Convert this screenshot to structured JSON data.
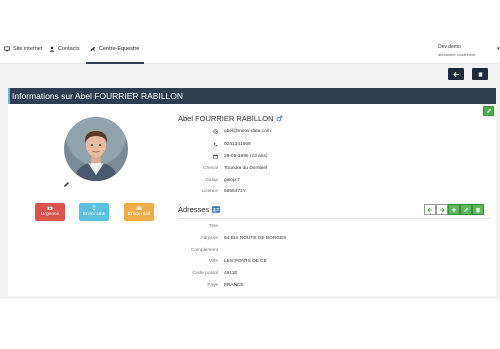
{
  "nav": {
    "tabs": [
      {
        "label": "Site internet",
        "icon": "desktop-icon"
      },
      {
        "label": "Contacts",
        "icon": "user-icon"
      },
      {
        "label": "Centre-Equestre",
        "icon": "horse-icon"
      }
    ],
    "user_name": "Dev demo",
    "user_sub": "alexandre coudreuse"
  },
  "toolbar": {
    "back_icon": "arrow-left-icon",
    "stop_icon": "stop-icon"
  },
  "page_title": "Informations sur Abel FOURRIER RABILLON",
  "profile": {
    "actions": [
      {
        "label": "Urgence",
        "icon": "ambulance-icon",
        "color": "#d9534f"
      },
      {
        "label": "Envoi sms",
        "icon": "mobile-icon",
        "color": "#5bc0de"
      },
      {
        "label": "Envoi mail",
        "icon": "envelope-icon",
        "color": "#f0ad4e"
      }
    ]
  },
  "person": {
    "name": "Abel FOURRIER RABILLON",
    "gender_icon": "male-icon",
    "email": "abel@innov-data.com",
    "phone": "0241341669",
    "birth": "29-05-1995 (23 ans)",
    "cheval_label": "Cheval",
    "cheval": "Toundra du Dombief",
    "galop_label": "Galop",
    "galop": "galop 7",
    "licence_label": "Licence",
    "licence": "5655471Y"
  },
  "address": {
    "heading": "Adresses",
    "fields": [
      {
        "label": "Titre",
        "value": ""
      },
      {
        "label": "Adresse",
        "value": "64 BIS ROUTE DE BORGES"
      },
      {
        "label": "Complement",
        "value": ""
      },
      {
        "label": "Ville",
        "value": "LES PONTS DE CE"
      },
      {
        "label": "Code postal",
        "value": "49130"
      },
      {
        "label": "Pays",
        "value": "FRANCE"
      }
    ]
  },
  "colors": {
    "header": "#2c3e50",
    "accent": "#5bc0de",
    "green": "#5cb85c"
  }
}
